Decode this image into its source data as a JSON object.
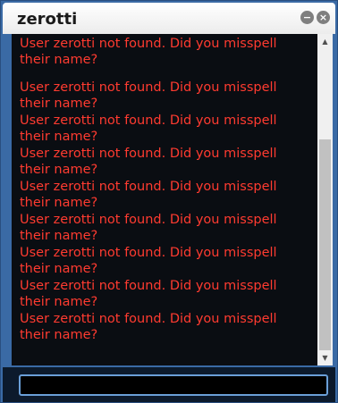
{
  "window": {
    "title": "zerotti",
    "minimize_label": "−",
    "close_label": "×"
  },
  "chat": {
    "messages": [
      {
        "line1": "User zerotti not found. Did you misspell",
        "line2": "their name?"
      },
      {
        "line1": "User zerotti not found. Did you misspell",
        "line2": "their name?"
      },
      {
        "line1": "User zerotti not found. Did you misspell",
        "line2": "their name?"
      },
      {
        "line1": "User zerotti not found. Did you misspell",
        "line2": "their name?"
      },
      {
        "line1": "User zerotti not found. Did you misspell",
        "line2": "their name?"
      },
      {
        "line1": "User zerotti not found. Did you misspell",
        "line2": "their name?"
      },
      {
        "line1": "User zerotti not found. Did you misspell",
        "line2": "their name?"
      },
      {
        "line1": "User zerotti not found. Did you misspell",
        "line2": "their name?"
      },
      {
        "line1": "User zerotti not found. Did you misspell",
        "line2": "their name?"
      }
    ],
    "message_color": "#ff3b30",
    "background_color": "#0a0d12"
  },
  "scrollbar": {
    "up_arrow": "▲",
    "down_arrow": "▼"
  },
  "input": {
    "value": "",
    "placeholder": ""
  },
  "icons": {
    "minimize": "minimize-icon",
    "close": "close-icon"
  }
}
